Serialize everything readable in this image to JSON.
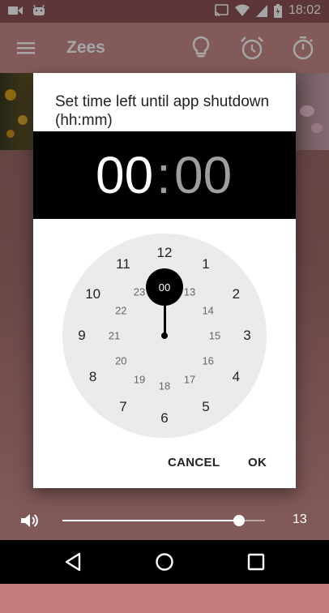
{
  "status_bar": {
    "time": "18:02",
    "icons": [
      "video-icon",
      "android-icon",
      "cast-icon",
      "wifi-icon",
      "signal-icon",
      "battery-icon"
    ]
  },
  "app_bar": {
    "title": "Zees",
    "icons": [
      "menu-icon",
      "lightbulb-icon",
      "alarm-icon",
      "stopwatch-icon"
    ]
  },
  "dialog": {
    "title": "Set time left until app shutdown (hh:mm)",
    "hours": "00",
    "separator": ":",
    "minutes": "00",
    "selected_value": "00",
    "outer_numbers": [
      "12",
      "1",
      "2",
      "3",
      "4",
      "5",
      "6",
      "7",
      "8",
      "9",
      "10",
      "11"
    ],
    "inner_numbers": [
      "00",
      "13",
      "14",
      "15",
      "16",
      "17",
      "18",
      "19",
      "20",
      "21",
      "22",
      "23"
    ],
    "cancel_label": "CANCEL",
    "ok_label": "OK"
  },
  "volume": {
    "value": "13",
    "level_fraction": 0.87
  },
  "nav_bar": {
    "icons": [
      "back-icon",
      "home-icon",
      "recents-icon"
    ]
  },
  "colors": {
    "app_bar": "#c98b8b",
    "status_bar": "#8e5456",
    "dialog_header": "#000000",
    "clock_face": "#eceaea"
  }
}
